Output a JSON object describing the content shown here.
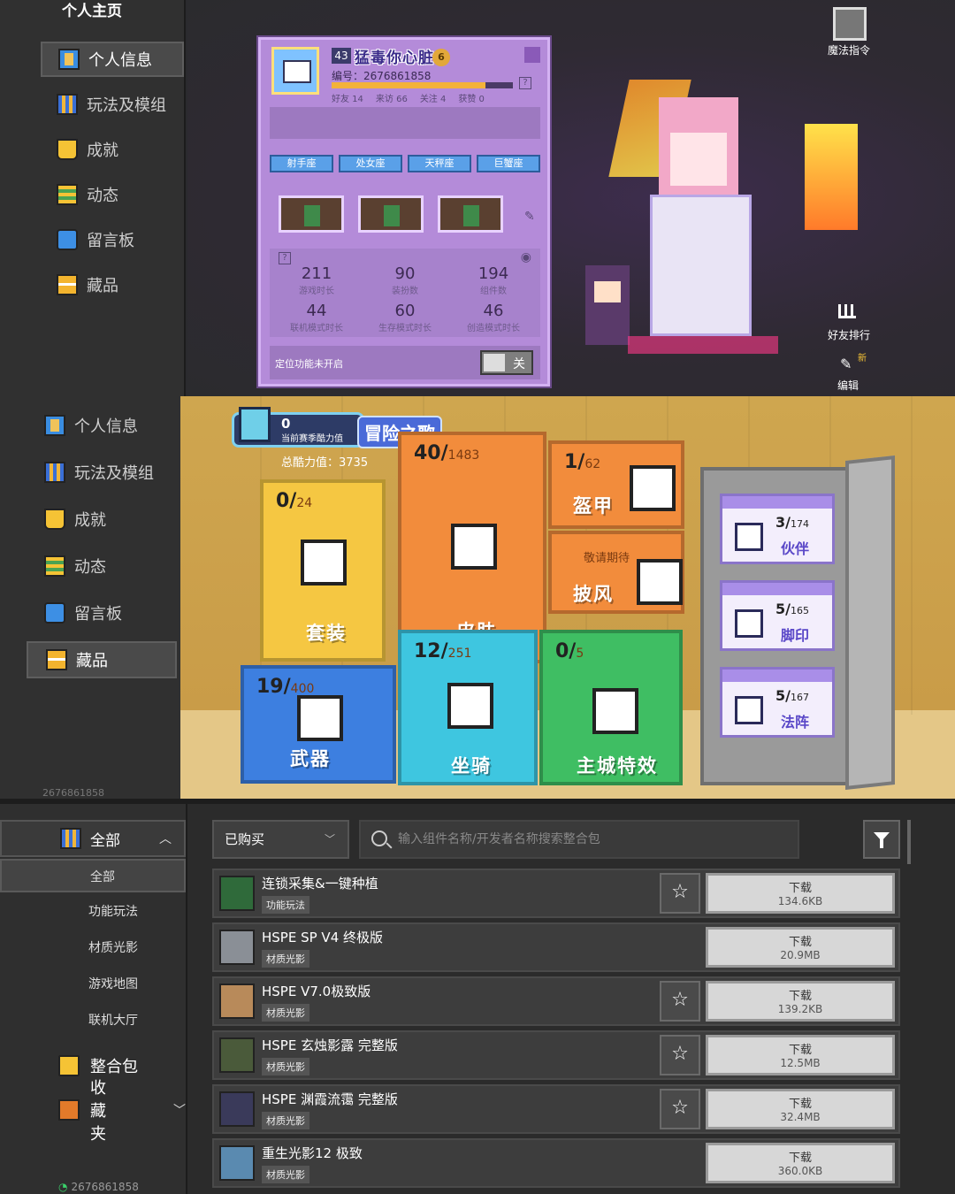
{
  "colors": {
    "accent_purple": "#b48bd9",
    "download_bg": "#d7d7d7",
    "online_green": "#3ad16a"
  },
  "panel1": {
    "home_title": "个人主页",
    "sidebar": [
      {
        "label": "个人信息",
        "icon": "user-card-icon",
        "active": true
      },
      {
        "label": "玩法及模组",
        "icon": "game-mods-icon",
        "active": false
      },
      {
        "label": "成就",
        "icon": "trophy-icon",
        "active": false
      },
      {
        "label": "动态",
        "icon": "feed-icon",
        "active": false
      },
      {
        "label": "留言板",
        "icon": "message-board-icon",
        "active": false
      },
      {
        "label": "藏品",
        "icon": "collection-box-icon",
        "active": false
      }
    ],
    "card": {
      "level": "43",
      "nickname": "猛毒你心脏",
      "badge": "6",
      "id_text": "编号：2676861858",
      "xp_progress": 0.85,
      "stats_line": [
        "好友 14",
        "来访 66",
        "关注 4",
        "获赞 0"
      ],
      "zodiacs": [
        "射手座",
        "处女座",
        "天秤座",
        "巨蟹座"
      ],
      "stats": [
        {
          "value": "211",
          "label": "游戏时长"
        },
        {
          "value": "90",
          "label": "装扮数"
        },
        {
          "value": "194",
          "label": "组件数"
        },
        {
          "value": "44",
          "label": "联机模式时长"
        },
        {
          "value": "60",
          "label": "生存模式时长"
        },
        {
          "value": "46",
          "label": "创造模式时长"
        }
      ],
      "location_text": "定位功能未开启",
      "toggle_label": "关"
    },
    "magic_cmd": "魔法指令",
    "friend_rank": "好友排行",
    "edit": "编辑",
    "new_tag": "新"
  },
  "panel2": {
    "sidebar": [
      {
        "label": "个人信息",
        "icon": "user-card-icon",
        "active": false
      },
      {
        "label": "玩法及模组",
        "icon": "game-mods-icon",
        "active": false
      },
      {
        "label": "成就",
        "icon": "trophy-icon",
        "active": false
      },
      {
        "label": "动态",
        "icon": "feed-icon",
        "active": false
      },
      {
        "label": "留言板",
        "icon": "message-board-icon",
        "active": false
      },
      {
        "label": "藏品",
        "icon": "collection-box-icon",
        "active": true
      }
    ],
    "season_value": "0",
    "season_label": "当前赛季酷力值",
    "season_name": "冒险之歌",
    "total": "总酷力值：3735",
    "lockers": [
      {
        "key": "suit",
        "owned": "0/",
        "total": "24",
        "title": "套装"
      },
      {
        "key": "skin",
        "owned": "40/",
        "total": "1483",
        "title": "皮肤"
      },
      {
        "key": "hat",
        "owned": "1/",
        "total": "62",
        "title": "盔甲"
      },
      {
        "key": "cape",
        "owned": "",
        "total": "",
        "title": "披风",
        "note": "敬请期待"
      },
      {
        "key": "weapon",
        "owned": "19/",
        "total": "400",
        "title": "武器"
      },
      {
        "key": "mount",
        "owned": "12/",
        "total": "251",
        "title": "坐骑"
      },
      {
        "key": "fx",
        "owned": "0/",
        "total": "5",
        "title": "主城特效"
      }
    ],
    "tags": [
      {
        "owned": "3/",
        "total": "174",
        "title": "伙伴"
      },
      {
        "owned": "5/",
        "total": "165",
        "title": "脚印"
      },
      {
        "owned": "5/",
        "total": "167",
        "title": "法阵"
      }
    ]
  },
  "panel3": {
    "category_head": "全部",
    "subcats": [
      "全部",
      "功能玩法",
      "材质光影",
      "游戏地图",
      "联机大厅"
    ],
    "groups": [
      "整合包",
      "收藏夹"
    ],
    "online_id": "2676861858",
    "filter": "已购买",
    "search_placeholder": "输入组件名称/开发者名称搜索整合包",
    "items": [
      {
        "name": "连锁采集&一键种植",
        "tag": "功能玩法",
        "star": true,
        "dl": "下载",
        "size": "134.6KB",
        "thumb": "#2f6a3a"
      },
      {
        "name": "HSPE SP V4 终极版",
        "tag": "材质光影",
        "star": false,
        "dl": "下载",
        "size": "20.9MB",
        "thumb": "#8a8f96"
      },
      {
        "name": "HSPE V7.0极致版",
        "tag": "材质光影",
        "star": true,
        "dl": "下载",
        "size": "139.2KB",
        "thumb": "#b88a5a"
      },
      {
        "name": "HSPE 玄烛影露 完整版",
        "tag": "材质光影",
        "star": true,
        "dl": "下载",
        "size": "12.5MB",
        "thumb": "#4a5a3a"
      },
      {
        "name": "HSPE 渊霞流霭 完整版",
        "tag": "材质光影",
        "star": true,
        "dl": "下载",
        "size": "32.4MB",
        "thumb": "#3a3a5a"
      },
      {
        "name": "重生光影12 极致",
        "tag": "材质光影",
        "star": false,
        "dl": "下载",
        "size": "360.0KB",
        "thumb": "#5a8ab0"
      }
    ]
  }
}
